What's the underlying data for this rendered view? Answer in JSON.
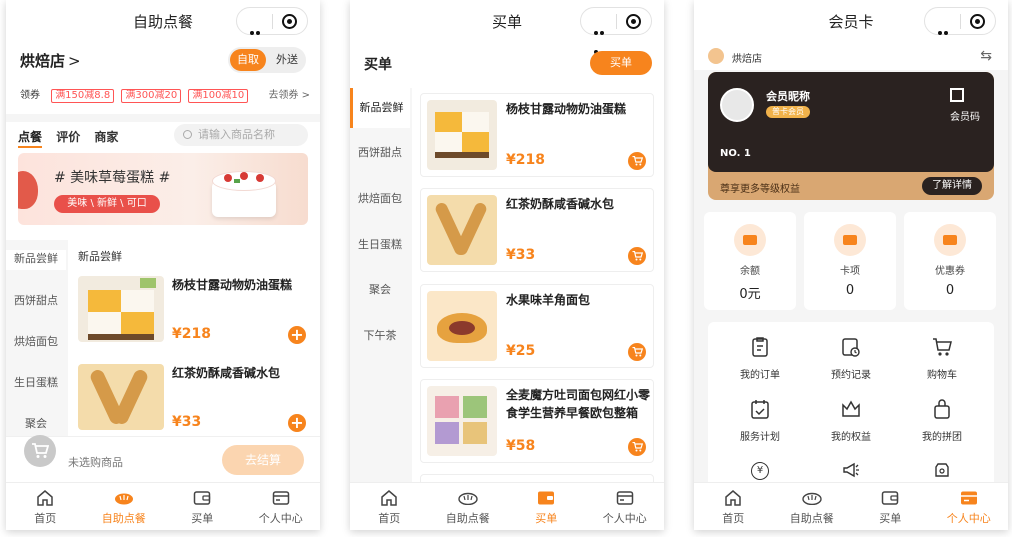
{
  "screen1": {
    "title": "自助点餐",
    "store_name": "烘焙店",
    "toggle": {
      "active": "自取",
      "inactive": "外送"
    },
    "coupon_label": "领券",
    "coupons": [
      "满150减8.8",
      "满300减20",
      "满100减10"
    ],
    "coupon_link": "去领券",
    "tabs": [
      "点餐",
      "评价",
      "商家"
    ],
    "search_placeholder": "请输入商品名称",
    "banner": {
      "title": "# 美味草莓蛋糕 #",
      "subtitle": "美味 \\ 新鲜 \\ 可口"
    },
    "categories": [
      "新品尝鲜",
      "西饼甜点",
      "烘焙面包",
      "生日蛋糕",
      "聚会"
    ],
    "section_title": "新品尝鲜",
    "products": [
      {
        "name": "杨枝甘露动物奶油蛋糕",
        "price": "¥218"
      },
      {
        "name": "红茶奶酥咸香碱水包",
        "price": "¥33"
      }
    ],
    "cart_empty": "未选购商品",
    "checkout": "去结算"
  },
  "screen2": {
    "title": "买单",
    "header": "买单",
    "pay_button": "买单",
    "categories": [
      "新品尝鲜",
      "西饼甜点",
      "烘焙面包",
      "生日蛋糕",
      "聚会",
      "下午茶"
    ],
    "products": [
      {
        "name": "杨枝甘露动物奶油蛋糕",
        "price": "¥218"
      },
      {
        "name": "红茶奶酥咸香碱水包",
        "price": "¥33"
      },
      {
        "name": "水果味羊角面包",
        "price": "¥25"
      },
      {
        "name": "全麦魔方吐司面包网红小零食学生营养早餐欧包整箱",
        "price": "¥58"
      }
    ]
  },
  "screen3": {
    "title": "会员卡",
    "store_name": "烘焙店",
    "card": {
      "nickname": "会员昵称",
      "level": "普卡会员",
      "qr_label": "会员码",
      "number": "NO. 1",
      "benefits": "尊享更多等级权益",
      "detail_button": "了解详情"
    },
    "stats": [
      {
        "label": "余额",
        "value": "0元"
      },
      {
        "label": "卡项",
        "value": "0"
      },
      {
        "label": "优惠券",
        "value": "0"
      }
    ],
    "menu": [
      "我的订单",
      "预约记录",
      "购物车",
      "服务计划",
      "我的权益",
      "我的拼团"
    ]
  },
  "tabbar": [
    "首页",
    "自助点餐",
    "买单",
    "个人中心"
  ],
  "colors": {
    "accent": "#f7841d",
    "coupon": "#ff5555",
    "card_dark": "#2a2220",
    "card_gold": "#d9a772"
  }
}
